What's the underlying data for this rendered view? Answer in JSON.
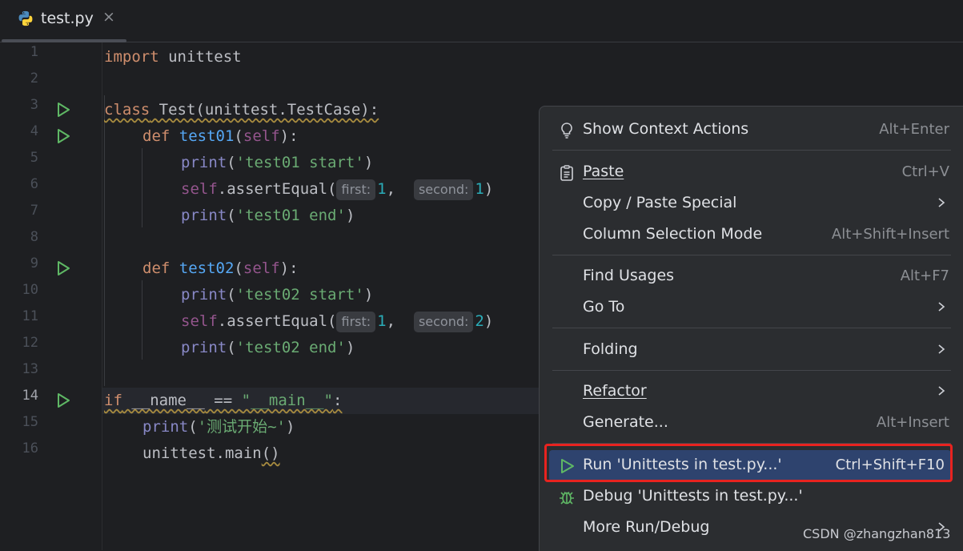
{
  "tab": {
    "title": "test.py",
    "close": "×"
  },
  "gutter": {
    "line_numbers": [
      "1",
      "2",
      "3",
      "4",
      "5",
      "6",
      "7",
      "8",
      "9",
      "10",
      "11",
      "12",
      "13",
      "14",
      "15",
      "16"
    ],
    "current_line": "14"
  },
  "code": {
    "l1": {
      "kw": "import",
      "rest": " unittest"
    },
    "l3": {
      "kw": "class",
      "rest": " Test(unittest.TestCase):"
    },
    "l4": {
      "kw": "def",
      "fn": "test01",
      "open": "(",
      "self": "self",
      "close": "):"
    },
    "l5": {
      "bi": "print",
      "open": "(",
      "str": "'test01 start'",
      "close": ")"
    },
    "l6": {
      "self": "self",
      "call": ".assertEqual(",
      "hint1": "first:",
      "v1": "1",
      "comma": ", ",
      "hint2": "second:",
      "v2": "1",
      "close": ")"
    },
    "l7": {
      "bi": "print",
      "open": "(",
      "str": "'test01 end'",
      "close": ")"
    },
    "l9": {
      "kw": "def",
      "fn": "test02",
      "open": "(",
      "self": "self",
      "close": "):"
    },
    "l10": {
      "bi": "print",
      "open": "(",
      "str": "'test02 start'",
      "close": ")"
    },
    "l11": {
      "self": "self",
      "call": ".assertEqual(",
      "hint1": "first:",
      "v1": "1",
      "comma": ", ",
      "hint2": "second:",
      "v2": "2",
      "close": ")"
    },
    "l12": {
      "bi": "print",
      "open": "(",
      "str": "'test02 end'",
      "close": ")"
    },
    "l14": {
      "kw": "if",
      "name": " __name__",
      "op": " == ",
      "str": "\"__main__\"",
      "colon": ":"
    },
    "l15": {
      "bi": "print",
      "open": "(",
      "str": "'测试开始~'",
      "close": ")"
    },
    "l16": {
      "text": "unittest.main",
      "parens": "()"
    }
  },
  "menu": {
    "items": [
      {
        "label": "Show Context Actions",
        "shortcut": "Alt+Enter",
        "icon": "lightbulb-icon"
      },
      {
        "label": "Paste",
        "shortcut": "Ctrl+V",
        "icon": "clipboard-icon"
      },
      {
        "label": "Copy / Paste Special",
        "submenu": true
      },
      {
        "label": "Column Selection Mode",
        "shortcut": "Alt+Shift+Insert"
      },
      {
        "label": "Find Usages",
        "shortcut": "Alt+F7"
      },
      {
        "label": "Go To",
        "submenu": true
      },
      {
        "label": "Folding",
        "submenu": true
      },
      {
        "label": "Refactor",
        "submenu": true
      },
      {
        "label": "Generate...",
        "shortcut": "Alt+Insert"
      },
      {
        "label": "Run 'Unittests in test.py...'",
        "shortcut": "Ctrl+Shift+F10",
        "icon": "run-icon",
        "selected": true
      },
      {
        "label": "Debug 'Unittests in test.py...'",
        "icon": "debug-icon"
      },
      {
        "label": "More Run/Debug",
        "submenu": true
      }
    ]
  },
  "watermark": "CSDN @zhangzhan813",
  "colors": {
    "accent": "#2e436e",
    "highlight_box": "#e8231f",
    "run_green": "#5fb865"
  }
}
